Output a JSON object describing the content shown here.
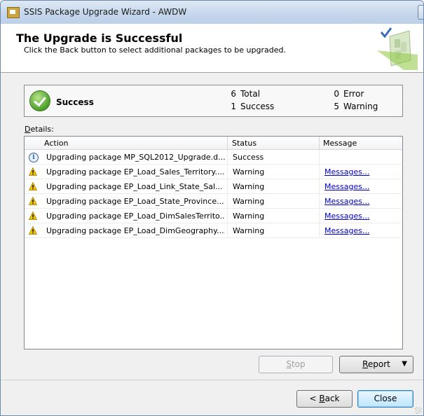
{
  "window": {
    "title": "SSIS Package Upgrade Wizard - AWDW",
    "minimize_glyph": "—",
    "maximize_glyph": "□",
    "close_glyph": "✕"
  },
  "header": {
    "title": "The Upgrade is Successful",
    "subtitle": "Click the Back button to select additional packages to be upgraded."
  },
  "summary": {
    "status": "Success",
    "total_count": "6",
    "total_label": "Total",
    "success_count": "1",
    "success_label": "Success",
    "error_count": "0",
    "error_label": "Error",
    "warning_count": "5",
    "warning_label": "Warning"
  },
  "details": {
    "label_prefix": "D",
    "label_rest": "etails:",
    "columns": {
      "action": "Action",
      "status": "Status",
      "message": "Message"
    },
    "rows": [
      {
        "icon": "info-icon",
        "action": "Upgrading package MP_SQL2012_Upgrade.d...",
        "status": "Success",
        "message": ""
      },
      {
        "icon": "warning-icon",
        "action": "Upgrading package EP_Load_Sales_Territory....",
        "status": "Warning",
        "message": "Messages..."
      },
      {
        "icon": "warning-icon",
        "action": "Upgrading package EP_Load_Link_State_Sal...",
        "status": "Warning",
        "message": "Messages..."
      },
      {
        "icon": "warning-icon",
        "action": "Upgrading package EP_Load_State_Province...",
        "status": "Warning",
        "message": "Messages..."
      },
      {
        "icon": "warning-icon",
        "action": "Upgrading package EP_Load_DimSalesTerrito...",
        "status": "Warning",
        "message": "Messages..."
      },
      {
        "icon": "warning-icon",
        "action": "Upgrading package EP_Load_DimGeography....",
        "status": "Warning",
        "message": "Messages..."
      }
    ]
  },
  "buttons": {
    "stop_u": "S",
    "stop_rest": "top",
    "report_u": "R",
    "report_rest": "eport",
    "report_arrow": "▼",
    "back_pre": "< ",
    "back_u": "B",
    "back_rest": "ack",
    "close": "Close"
  },
  "colors": {
    "link": "#0000cc",
    "success_green": "#4d9f2a",
    "warning_yellow": "#f5c400",
    "info_blue": "#2a5fb0"
  }
}
